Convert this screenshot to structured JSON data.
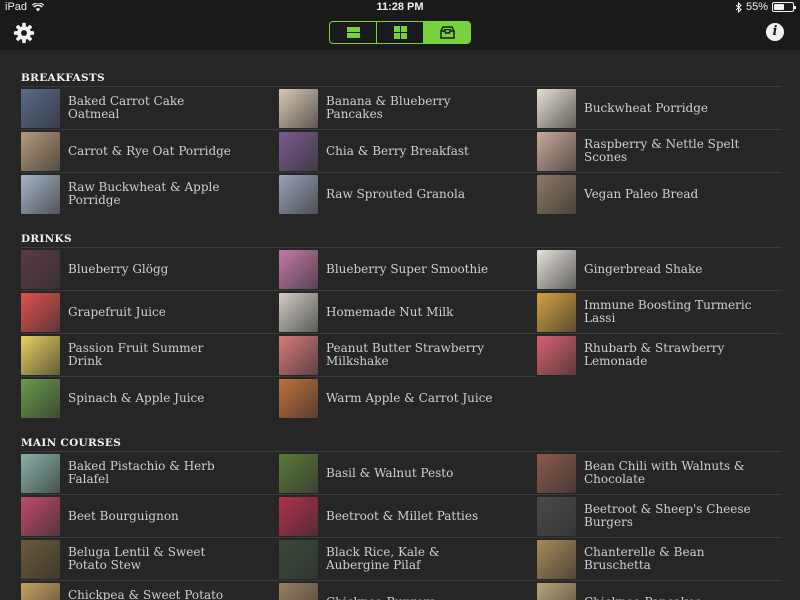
{
  "status_bar": {
    "device": "iPad",
    "time": "11:28 PM",
    "battery_text": "55%",
    "battery_level": 0.55
  },
  "nav": {
    "settings_icon": "gear-icon",
    "info_label": "i",
    "view_modes": [
      {
        "icon": "list-view-icon",
        "active": false
      },
      {
        "icon": "grid-view-icon",
        "active": false
      },
      {
        "icon": "tray-view-icon",
        "active": true
      }
    ]
  },
  "colors": {
    "accent": "#78d23c",
    "background": "#262626",
    "bar": "#1a1a1a"
  },
  "sections": [
    {
      "title": "BREAKFASTS",
      "items": [
        {
          "name": "Baked Carrot Cake Oatmeal",
          "color": "#5a6a8a"
        },
        {
          "name": "Banana & Blueberry Pancakes",
          "color": "#d9c8b4"
        },
        {
          "name": "Buckwheat Porridge",
          "color": "#e6dfd2"
        },
        {
          "name": "Carrot & Rye Oat Porridge",
          "color": "#b59a7a"
        },
        {
          "name": "Chia & Berry Breakfast",
          "color": "#7a5a8e"
        },
        {
          "name": "Raspberry & Nettle Spelt Scones",
          "color": "#c9a99a"
        },
        {
          "name": "Raw Buckwheat & Apple Porridge",
          "color": "#a8b4c8"
        },
        {
          "name": "Raw Sprouted Granola",
          "color": "#9aa4b8"
        },
        {
          "name": "Vegan Paleo Bread",
          "color": "#8c7a66"
        }
      ]
    },
    {
      "title": "DRINKS",
      "items": [
        {
          "name": "Blueberry Glögg",
          "color": "#5a3a44"
        },
        {
          "name": "Blueberry Super Smoothie",
          "color": "#c47aa8"
        },
        {
          "name": "Gingerbread Shake",
          "color": "#e6e2dc"
        },
        {
          "name": "Grapefruit Juice",
          "color": "#e05050"
        },
        {
          "name": "Homemade Nut Milk",
          "color": "#d0ccc4"
        },
        {
          "name": "Immune Boosting Turmeric Lassi",
          "color": "#d4a040"
        },
        {
          "name": "Passion Fruit Summer Drink",
          "color": "#e8d060"
        },
        {
          "name": "Peanut Butter Strawberry Milkshake",
          "color": "#d87a7a"
        },
        {
          "name": "Rhubarb & Strawberry Lemonade",
          "color": "#d86070"
        },
        {
          "name": "Spinach & Apple Juice",
          "color": "#6a9a4a"
        },
        {
          "name": "Warm Apple & Carrot Juice",
          "color": "#c0703a"
        }
      ]
    },
    {
      "title": "MAIN COURSES",
      "items": [
        {
          "name": "Baked Pistachio & Herb Falafel",
          "color": "#8ab0a8"
        },
        {
          "name": "Basil & Walnut Pesto",
          "color": "#5a7a3a"
        },
        {
          "name": "Bean Chili with Walnuts & Chocolate",
          "color": "#8a5a4a"
        },
        {
          "name": "Beet Bourguignon",
          "color": "#c04a6a"
        },
        {
          "name": "Beetroot & Millet Patties",
          "color": "#b0304a"
        },
        {
          "name": "Beetroot & Sheep's Cheese Burgers",
          "color": "#4a4a4a"
        },
        {
          "name": "Beluga Lentil & Sweet Potato Stew",
          "color": "#6a5a3a"
        },
        {
          "name": "Black Rice, Kale & Aubergine Pilaf",
          "color": "#3a4a3a"
        },
        {
          "name": "Chanterelle & Bean Bruschetta",
          "color": "#a88a5a"
        },
        {
          "name": "Chickpea & Sweet Potato Curry",
          "color": "#c8a060"
        },
        {
          "name": "Chickpea Burgers",
          "color": "#9a8060"
        },
        {
          "name": "Chickpea Pancakes",
          "color": "#b8a478"
        }
      ]
    }
  ]
}
